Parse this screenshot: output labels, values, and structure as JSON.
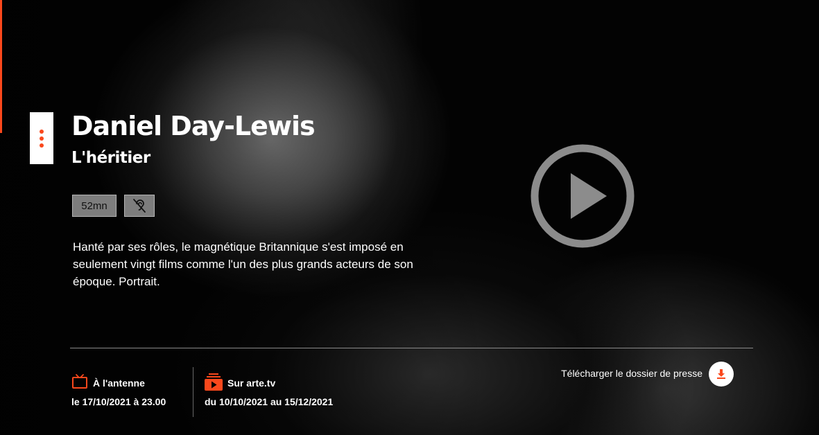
{
  "program": {
    "title": "Daniel Day-Lewis",
    "subtitle": "L'héritier",
    "duration": "52mn",
    "description": "Hanté par ses rôles, le magnétique Britannique s'est imposé en seulement vingt films comme l'un des plus grands acteurs de son époque. Portrait."
  },
  "broadcast": {
    "label": "À l'antenne",
    "date": "le 17/10/2021 à 23.00",
    "icon": "tv-icon"
  },
  "online": {
    "label": "Sur arte.tv",
    "date": "du 10/10/2021 au 15/12/2021",
    "icon": "arte-tv-icon"
  },
  "press": {
    "label": "Télécharger le dossier de presse",
    "icon": "download-icon"
  },
  "icons": {
    "menu": "more-vertical-icon",
    "accessibility": "hearing-impaired-icon",
    "play": "play-icon"
  },
  "colors": {
    "accent": "#fa481c",
    "badge_bg": "#7d7d7d",
    "play": "#8c8c8c"
  }
}
